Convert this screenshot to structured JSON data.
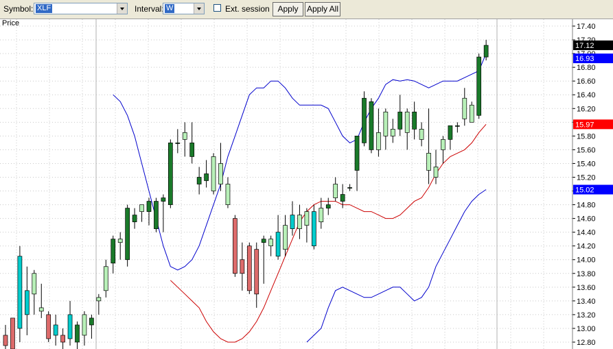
{
  "toolbar": {
    "symbol_label": "Symbol:",
    "symbol_value": "XLF",
    "interval_label": "Interval:",
    "interval_value": "W",
    "ext_session_label": "Ext. session",
    "ext_session_checked": false,
    "apply_label": "Apply",
    "apply_all_label": "Apply All"
  },
  "chart_data": {
    "type": "candlestick",
    "title": "Price",
    "ylim": [
      12.7,
      17.5
    ],
    "yticks": [
      "17.40",
      "17.20",
      "17.00",
      "16.80",
      "16.60",
      "16.40",
      "16.20",
      "16.00",
      "15.80",
      "15.60",
      "15.40",
      "15.20",
      "15.00",
      "14.80",
      "14.60",
      "14.40",
      "14.20",
      "14.00",
      "13.80",
      "13.60",
      "13.40",
      "13.20",
      "13.00",
      "12.80"
    ],
    "price_labels": [
      {
        "text": "17.12",
        "value": 17.12,
        "color": "#000000"
      },
      {
        "text": "16.93",
        "value": 16.93,
        "color": "#0000ff"
      },
      {
        "text": "15.97",
        "value": 15.97,
        "color": "#ff0000"
      },
      {
        "text": "15.02",
        "value": 15.02,
        "color": "#0000ff"
      }
    ],
    "colors": {
      "up": "#00cccc",
      "down": "#dd6b6b",
      "up_bull": "#1a7a2a",
      "up_pale": "#b8f0b8",
      "upper_band": "#0000cc",
      "middle_band": "#cc0000",
      "lower_band": "#0000cc"
    },
    "candles": [
      {
        "o": 12.75,
        "h": 13.05,
        "l": 12.7,
        "c": 12.9,
        "color": "down"
      },
      {
        "o": 13.15,
        "h": 13.15,
        "l": 12.7,
        "c": 12.7,
        "color": "down"
      },
      {
        "o": 13.0,
        "h": 14.2,
        "l": 12.8,
        "c": 14.05,
        "color": "up"
      },
      {
        "o": 13.2,
        "h": 13.9,
        "l": 12.9,
        "c": 13.55,
        "color": "up"
      },
      {
        "o": 13.5,
        "h": 13.85,
        "l": 13.2,
        "c": 13.8,
        "color": "up_pale"
      },
      {
        "o": 13.25,
        "h": 13.65,
        "l": 13.15,
        "c": 13.3,
        "color": "up_pale"
      },
      {
        "o": 13.2,
        "h": 13.25,
        "l": 12.8,
        "c": 12.85,
        "color": "down"
      },
      {
        "o": 13.05,
        "h": 13.2,
        "l": 12.75,
        "c": 12.9,
        "color": "up"
      },
      {
        "o": 12.9,
        "h": 13.0,
        "l": 12.7,
        "c": 12.8,
        "color": "down"
      },
      {
        "o": 12.85,
        "h": 13.4,
        "l": 12.75,
        "c": 13.2,
        "color": "up"
      },
      {
        "o": 12.8,
        "h": 13.1,
        "l": 12.7,
        "c": 13.05,
        "color": "up_bull"
      },
      {
        "o": 12.9,
        "h": 13.25,
        "l": 12.75,
        "c": 13.2,
        "color": "up_pale"
      },
      {
        "o": 13.05,
        "h": 13.2,
        "l": 12.85,
        "c": 13.15,
        "color": "up_bull"
      },
      {
        "o": 13.4,
        "h": 13.5,
        "l": 13.2,
        "c": 13.45,
        "color": "up_pale"
      },
      {
        "o": 13.55,
        "h": 14.0,
        "l": 13.45,
        "c": 13.9,
        "color": "up_pale"
      },
      {
        "o": 13.95,
        "h": 14.35,
        "l": 13.8,
        "c": 14.3,
        "color": "up_bull"
      },
      {
        "o": 14.3,
        "h": 14.4,
        "l": 14.0,
        "c": 14.25,
        "color": "up_pale"
      },
      {
        "o": 14.0,
        "h": 14.8,
        "l": 13.9,
        "c": 14.75,
        "color": "up_bull"
      },
      {
        "o": 14.55,
        "h": 14.75,
        "l": 14.45,
        "c": 14.65,
        "color": "up_bull"
      },
      {
        "o": 14.7,
        "h": 14.8,
        "l": 14.55,
        "c": 14.8,
        "color": "up_pale"
      },
      {
        "o": 14.7,
        "h": 14.9,
        "l": 14.5,
        "c": 14.85,
        "color": "up_bull"
      },
      {
        "o": 14.45,
        "h": 14.9,
        "l": 14.4,
        "c": 14.85,
        "color": "up_bull"
      },
      {
        "o": 14.85,
        "h": 14.95,
        "l": 14.4,
        "c": 14.9,
        "color": "up_bull"
      },
      {
        "o": 14.8,
        "h": 15.75,
        "l": 14.75,
        "c": 15.7,
        "color": "up_bull"
      },
      {
        "o": 15.7,
        "h": 15.9,
        "l": 15.55,
        "c": 15.7,
        "color": "up_bull"
      },
      {
        "o": 15.85,
        "h": 16.0,
        "l": 15.5,
        "c": 15.75,
        "color": "up_pale"
      },
      {
        "o": 15.7,
        "h": 16.0,
        "l": 15.4,
        "c": 15.5,
        "color": "up_bull"
      },
      {
        "o": 15.2,
        "h": 15.35,
        "l": 14.95,
        "c": 15.1,
        "color": "up_bull"
      },
      {
        "o": 15.15,
        "h": 15.45,
        "l": 15.05,
        "c": 15.25,
        "color": "up_bull"
      },
      {
        "o": 15.5,
        "h": 15.55,
        "l": 14.95,
        "c": 15.0,
        "color": "up_pale"
      },
      {
        "o": 15.4,
        "h": 15.7,
        "l": 15.0,
        "c": 15.1,
        "color": "up_pale"
      },
      {
        "o": 15.1,
        "h": 15.2,
        "l": 14.75,
        "c": 14.8,
        "color": "up_pale"
      },
      {
        "o": 14.6,
        "h": 14.65,
        "l": 13.75,
        "c": 13.8,
        "color": "down"
      },
      {
        "o": 13.8,
        "h": 14.25,
        "l": 13.55,
        "c": 14.0,
        "color": "down"
      },
      {
        "o": 14.2,
        "h": 14.25,
        "l": 13.5,
        "c": 13.55,
        "color": "down"
      },
      {
        "o": 14.15,
        "h": 14.25,
        "l": 13.3,
        "c": 13.5,
        "color": "down"
      },
      {
        "o": 14.3,
        "h": 14.35,
        "l": 13.65,
        "c": 14.25,
        "color": "up_bull"
      },
      {
        "o": 14.2,
        "h": 14.35,
        "l": 14.05,
        "c": 14.3,
        "color": "up_pale"
      },
      {
        "o": 14.4,
        "h": 14.65,
        "l": 14.0,
        "c": 14.05,
        "color": "up"
      },
      {
        "o": 14.5,
        "h": 14.65,
        "l": 14.05,
        "c": 14.15,
        "color": "up_pale"
      },
      {
        "o": 14.65,
        "h": 14.85,
        "l": 14.35,
        "c": 14.45,
        "color": "up"
      },
      {
        "o": 14.65,
        "h": 14.8,
        "l": 14.3,
        "c": 14.45,
        "color": "up_pale"
      },
      {
        "o": 14.7,
        "h": 14.75,
        "l": 14.25,
        "c": 14.5,
        "color": "up_pale"
      },
      {
        "o": 14.7,
        "h": 14.8,
        "l": 14.15,
        "c": 14.2,
        "color": "up"
      },
      {
        "o": 14.75,
        "h": 14.9,
        "l": 14.45,
        "c": 14.55,
        "color": "up_pale"
      },
      {
        "o": 14.8,
        "h": 14.9,
        "l": 14.65,
        "c": 14.75,
        "color": "up_bull"
      },
      {
        "o": 14.9,
        "h": 15.2,
        "l": 14.85,
        "c": 15.1,
        "color": "up_pale"
      },
      {
        "o": 14.95,
        "h": 15.1,
        "l": 14.75,
        "c": 14.85,
        "color": "up_bull"
      },
      {
        "o": 15.05,
        "h": 15.1,
        "l": 15.0,
        "c": 15.05,
        "color": "up_bull"
      },
      {
        "o": 15.3,
        "h": 15.8,
        "l": 15.0,
        "c": 15.8,
        "color": "up_bull"
      },
      {
        "o": 15.7,
        "h": 16.45,
        "l": 15.65,
        "c": 16.35,
        "color": "up_bull"
      },
      {
        "o": 16.3,
        "h": 16.35,
        "l": 15.55,
        "c": 15.6,
        "color": "up_bull"
      },
      {
        "o": 15.85,
        "h": 16.2,
        "l": 15.5,
        "c": 15.6,
        "color": "up_pale"
      },
      {
        "o": 15.8,
        "h": 16.2,
        "l": 15.6,
        "c": 16.15,
        "color": "up_pale"
      },
      {
        "o": 15.8,
        "h": 16.05,
        "l": 15.7,
        "c": 15.9,
        "color": "up_pale"
      },
      {
        "o": 16.15,
        "h": 16.4,
        "l": 15.8,
        "c": 15.9,
        "color": "up_bull"
      },
      {
        "o": 15.85,
        "h": 16.2,
        "l": 15.6,
        "c": 16.15,
        "color": "up_pale"
      },
      {
        "o": 16.15,
        "h": 16.3,
        "l": 15.75,
        "c": 15.9,
        "color": "up_bull"
      },
      {
        "o": 15.75,
        "h": 16.0,
        "l": 15.65,
        "c": 15.9,
        "color": "up_pale"
      },
      {
        "o": 15.3,
        "h": 16.2,
        "l": 15.1,
        "c": 15.55,
        "color": "up_pale"
      },
      {
        "o": 15.35,
        "h": 15.6,
        "l": 15.1,
        "c": 15.2,
        "color": "up_pale"
      },
      {
        "o": 15.6,
        "h": 15.8,
        "l": 15.4,
        "c": 15.75,
        "color": "up_pale"
      },
      {
        "o": 15.75,
        "h": 15.95,
        "l": 15.6,
        "c": 15.95,
        "color": "up_bull"
      },
      {
        "o": 15.95,
        "h": 16.0,
        "l": 15.85,
        "c": 15.95,
        "color": "up_bull"
      },
      {
        "o": 16.35,
        "h": 16.5,
        "l": 15.95,
        "c": 16.05,
        "color": "up_pale"
      },
      {
        "o": 16.0,
        "h": 16.3,
        "l": 16.05,
        "c": 16.25,
        "color": "up_pale"
      },
      {
        "o": 16.1,
        "h": 17.0,
        "l": 16.05,
        "c": 16.95,
        "color": "up_bull"
      },
      {
        "o": 16.95,
        "h": 17.2,
        "l": 16.9,
        "c": 17.12,
        "color": "up_bull"
      }
    ],
    "upper_band": [
      16.4,
      16.3,
      16.1,
      15.8,
      15.4,
      15.0,
      14.6,
      14.2,
      13.9,
      13.85,
      13.9,
      14.0,
      14.2,
      14.5,
      14.8,
      15.1,
      15.5,
      15.8,
      16.1,
      16.4,
      16.5,
      16.5,
      16.6,
      16.6,
      16.5,
      16.35,
      16.25,
      16.25,
      16.25,
      16.25,
      16.2,
      16.0,
      15.8,
      15.7,
      15.75,
      16.0,
      16.2,
      16.35,
      16.55,
      16.62,
      16.6,
      16.62,
      16.6,
      16.55,
      16.5,
      16.55,
      16.6,
      16.6,
      16.6,
      16.65,
      16.7,
      16.75,
      17.0
    ],
    "middle_band": [
      13.7,
      13.6,
      13.5,
      13.4,
      13.3,
      13.1,
      12.95,
      12.85,
      12.8,
      12.8,
      12.85,
      12.95,
      13.1,
      13.3,
      13.55,
      13.8,
      14.05,
      14.3,
      14.55,
      14.7,
      14.8,
      14.85,
      14.85,
      14.85,
      14.8,
      14.8,
      14.75,
      14.7,
      14.7,
      14.65,
      14.6,
      14.6,
      14.65,
      14.75,
      14.85,
      14.9,
      15.05,
      15.25,
      15.4,
      15.5,
      15.55,
      15.6,
      15.7,
      15.85,
      15.97
    ],
    "lower_band": [
      12.8,
      12.9,
      13.0,
      13.3,
      13.55,
      13.6,
      13.55,
      13.5,
      13.45,
      13.45,
      13.5,
      13.55,
      13.6,
      13.6,
      13.5,
      13.4,
      13.45,
      13.6,
      13.9,
      14.1,
      14.3,
      14.5,
      14.7,
      14.85,
      14.95,
      15.02
    ]
  }
}
